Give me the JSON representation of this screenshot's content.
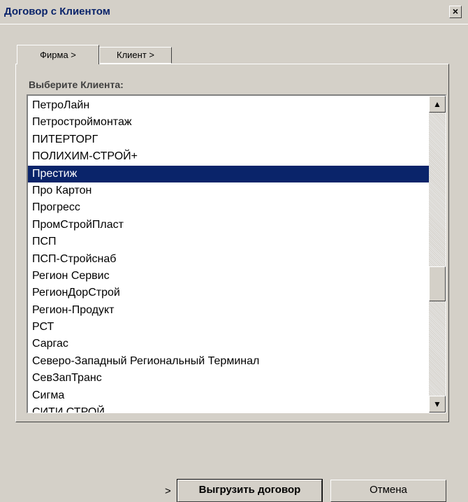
{
  "window": {
    "title": "Договор с Клиентом",
    "close_label": "×"
  },
  "tabs": [
    {
      "label": "Фирма >",
      "active": true
    },
    {
      "label": "Клиент >",
      "active": false
    }
  ],
  "list": {
    "label": "Выберите Клиента:",
    "selected_index": 4,
    "items": [
      "ПетроЛайн",
      "Петростроймонтаж",
      "ПИТЕРТОРГ",
      "ПОЛИХИМ-СТРОЙ+",
      "Престиж",
      "Про Картон",
      "Прогресс",
      "ПромСтройПласт",
      "ПСП",
      "ПСП-Стройснаб",
      "Регион Сервис",
      "РегионДорСтрой",
      "Регион-Продукт",
      "РСТ",
      "Саргас",
      "Северо-Западный Региональный Терминал",
      "СевЗапТранс",
      "Сигма",
      "СИТИ СТРОЙ"
    ]
  },
  "footer": {
    "step_marker": ">",
    "export_label": "Выгрузить договор",
    "cancel_label": "Отмена"
  }
}
